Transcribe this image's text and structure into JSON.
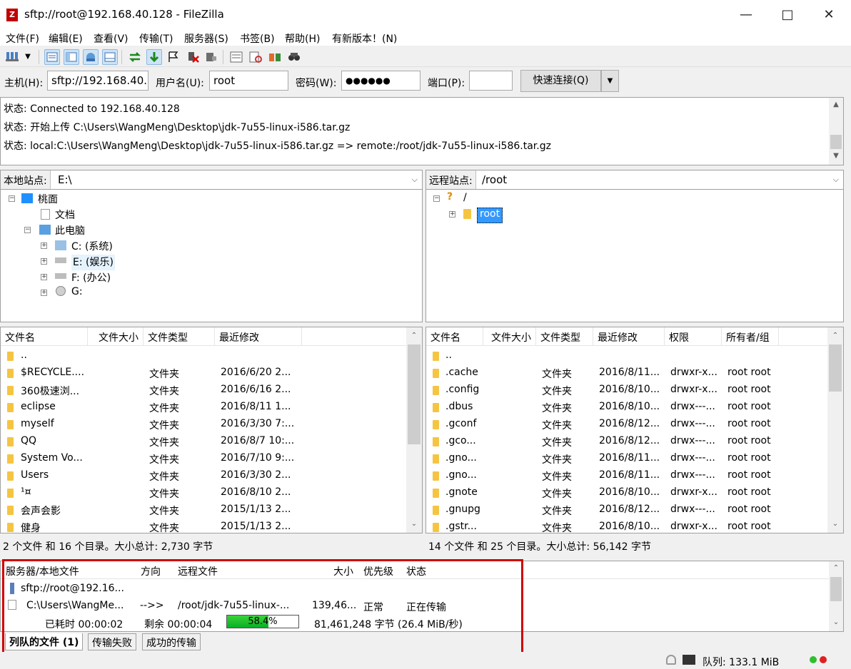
{
  "window": {
    "title": "sftp://root@192.168.40.128 - FileZilla",
    "app_icon": "filezilla-icon"
  },
  "menu": [
    "文件(F)",
    "编辑(E)",
    "查看(V)",
    "传输(T)",
    "服务器(S)",
    "书签(B)",
    "帮助(H)",
    "有新版本！(N)"
  ],
  "quickconnect": {
    "host_label": "主机(H):",
    "host_value": "sftp://192.168.40.1",
    "user_label": "用户名(U):",
    "user_value": "root",
    "pass_label": "密码(W):",
    "pass_value": "●●●●●●",
    "port_label": "端口(P):",
    "port_value": "",
    "connect_label": "快速连接(Q)"
  },
  "log": [
    "状态:  Connected to 192.168.40.128",
    "状态:  开始上传 C:\\Users\\WangMeng\\Desktop\\jdk-7u55-linux-i586.tar.gz",
    "状态:  local:C:\\Users\\WangMeng\\Desktop\\jdk-7u55-linux-i586.tar.gz => remote:/root/jdk-7u55-linux-i586.tar.gz"
  ],
  "local": {
    "site_label": "本地站点:",
    "path": "E:\\",
    "tree": [
      {
        "label": "桃面",
        "icon": "desktop-icon"
      },
      {
        "label": "文档",
        "icon": "document-icon"
      },
      {
        "label": "此电脑",
        "icon": "computer-icon"
      },
      {
        "label": "C: (系统)",
        "icon": "windows-drive-icon"
      },
      {
        "label": "E: (娱乐)",
        "icon": "drive-icon"
      },
      {
        "label": "F: (办公)",
        "icon": "drive-icon"
      },
      {
        "label": "G:",
        "icon": "cd-drive-icon"
      }
    ],
    "columns": [
      "文件名",
      "文件大小",
      "文件类型",
      "最近修改"
    ],
    "rows": [
      {
        "name": "..",
        "size": "",
        "type": "",
        "modified": ""
      },
      {
        "name": "$RECYCLE....",
        "size": "",
        "type": "文件夹",
        "modified": "2016/6/20 2..."
      },
      {
        "name": "360极速浏...",
        "size": "",
        "type": "文件夹",
        "modified": "2016/6/16 2..."
      },
      {
        "name": "eclipse",
        "size": "",
        "type": "文件夹",
        "modified": "2016/8/11 1..."
      },
      {
        "name": "myself",
        "size": "",
        "type": "文件夹",
        "modified": "2016/3/30 7:..."
      },
      {
        "name": "QQ",
        "size": "",
        "type": "文件夹",
        "modified": "2016/8/7 10:..."
      },
      {
        "name": "System Vo...",
        "size": "",
        "type": "文件夹",
        "modified": "2016/7/10 9:..."
      },
      {
        "name": "Users",
        "size": "",
        "type": "文件夹",
        "modified": "2016/3/30 2..."
      },
      {
        "name": "¹¤",
        "size": "",
        "type": "文件夹",
        "modified": "2016/8/10 2..."
      },
      {
        "name": "会声会影",
        "size": "",
        "type": "文件夹",
        "modified": "2015/1/13 2..."
      },
      {
        "name": "健身",
        "size": "",
        "type": "文件夹",
        "modified": "2015/1/13 2..."
      }
    ],
    "status": "2 个文件 和 16 个目录。大小总计: 2,730 字节"
  },
  "remote": {
    "site_label": "远程站点:",
    "path": "/root",
    "tree": [
      {
        "label": "/",
        "icon": "question-icon"
      },
      {
        "label": "root",
        "icon": "folder-icon"
      }
    ],
    "columns": [
      "文件名",
      "文件大小",
      "文件类型",
      "最近修改",
      "权限",
      "所有者/组"
    ],
    "rows": [
      {
        "name": "..",
        "type": "",
        "modified": "",
        "perm": "",
        "owner": ""
      },
      {
        "name": ".cache",
        "type": "文件夹",
        "modified": "2016/8/11...",
        "perm": "drwxr-x...",
        "owner": "root root"
      },
      {
        "name": ".config",
        "type": "文件夹",
        "modified": "2016/8/10...",
        "perm": "drwxr-x...",
        "owner": "root root"
      },
      {
        "name": ".dbus",
        "type": "文件夹",
        "modified": "2016/8/10...",
        "perm": "drwx---...",
        "owner": "root root"
      },
      {
        "name": ".gconf",
        "type": "文件夹",
        "modified": "2016/8/12...",
        "perm": "drwx---...",
        "owner": "root root"
      },
      {
        "name": ".gco...",
        "type": "文件夹",
        "modified": "2016/8/12...",
        "perm": "drwx---...",
        "owner": "root root"
      },
      {
        "name": ".gno...",
        "type": "文件夹",
        "modified": "2016/8/11...",
        "perm": "drwx---...",
        "owner": "root root"
      },
      {
        "name": ".gno...",
        "type": "文件夹",
        "modified": "2016/8/11...",
        "perm": "drwx---...",
        "owner": "root root"
      },
      {
        "name": ".gnote",
        "type": "文件夹",
        "modified": "2016/8/10...",
        "perm": "drwxr-x...",
        "owner": "root root"
      },
      {
        "name": ".gnupg",
        "type": "文件夹",
        "modified": "2016/8/12...",
        "perm": "drwx---...",
        "owner": "root root"
      },
      {
        "name": ".gstr...",
        "type": "文件夹",
        "modified": "2016/8/10...",
        "perm": "drwxr-x...",
        "owner": "root root"
      }
    ],
    "status": "14 个文件 和 25 个目录。大小总计: 56,142 字节"
  },
  "queue": {
    "columns": [
      "服务器/本地文件",
      "方向",
      "远程文件",
      "大小",
      "优先级",
      "状态"
    ],
    "server": "sftp://root@192.16...",
    "local_file": "C:\\Users\\WangMe...",
    "direction": "-->>",
    "remote_file": "/root/jdk-7u55-linux-...",
    "size": "139,46...",
    "priority": "正常",
    "state": "正在传输",
    "elapsed": "已耗时 00:00:02",
    "remaining": "剩余 00:00:04",
    "progress_percent": 58.4,
    "progress_label": "58.4%",
    "transferred": "81,461,248 字节 (26.4 MiB/秒)",
    "tabs": [
      "列队的文件 (1)",
      "传输失败",
      "成功的传输"
    ]
  },
  "statusbar": {
    "queue_text": "队列: 133.1 MiB"
  },
  "colors": {
    "selection": "#3399ff",
    "progress": "#06b025",
    "highlight_box": "#d00000"
  }
}
